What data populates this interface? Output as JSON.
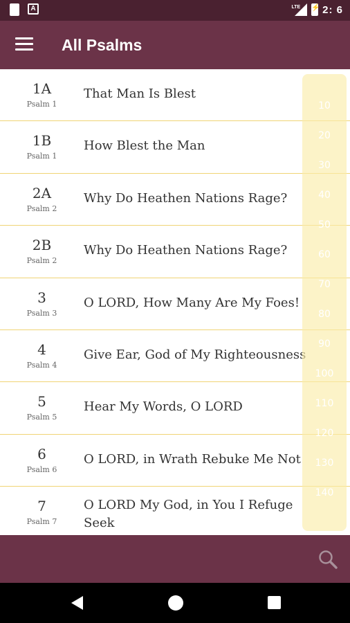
{
  "status_bar": {
    "time": "2: 6",
    "network": "LTE",
    "notification_icon_label": "A"
  },
  "app_bar": {
    "title": "All Psalms",
    "menu_icon": "hamburger-menu-icon"
  },
  "psalms": [
    {
      "number": "1A",
      "psalm": "Psalm 1",
      "title": "That Man Is Blest"
    },
    {
      "number": "1B",
      "psalm": "Psalm 1",
      "title": "How Blest the Man"
    },
    {
      "number": "2A",
      "psalm": "Psalm 2",
      "title": "Why Do Heathen Nations Rage?"
    },
    {
      "number": "2B",
      "psalm": "Psalm 2",
      "title": "Why Do Heathen Nations Rage?"
    },
    {
      "number": "3",
      "psalm": "Psalm 3",
      "title": "O LORD, How Many Are My Foes!"
    },
    {
      "number": "4",
      "psalm": "Psalm 4",
      "title": "Give Ear, God of My Righteousness"
    },
    {
      "number": "5",
      "psalm": "Psalm 5",
      "title": "Hear My Words, O LORD"
    },
    {
      "number": "6",
      "psalm": "Psalm 6",
      "title": "O LORD, in Wrath Rebuke Me Not"
    },
    {
      "number": "7",
      "psalm": "Psalm 7",
      "title": "O LORD My God, in You I Refuge Seek"
    }
  ],
  "index_scroller": [
    "10",
    "20",
    "30",
    "40",
    "50",
    "60",
    "70",
    "80",
    "90",
    "100",
    "110",
    "120",
    "130",
    "140"
  ],
  "bottom_bar": {
    "search_icon": "search-icon"
  },
  "colors": {
    "status_bar": "#4a2130",
    "app_bar": "#6b3348",
    "divider": "#f0d474",
    "index_bg": "#faecaa"
  }
}
